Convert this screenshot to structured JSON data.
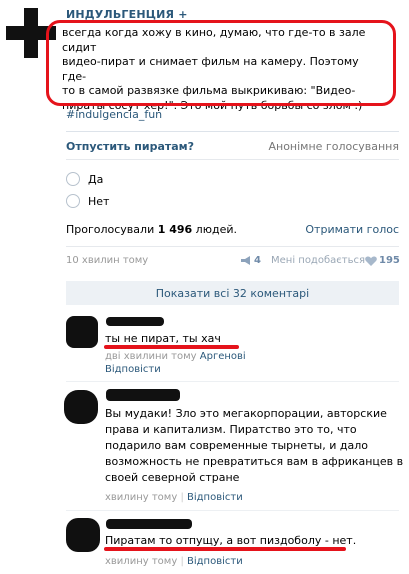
{
  "post": {
    "group_name": "ИНДУЛЬГЕНЦИЯ +",
    "text_lines": [
      "всегда когда хожу в кино, думаю, что где-то в зале сидит",
      "видео-пират и снимает фильм на камеру. Поэтому где-",
      "то в самой развязке фильма выкрикиваю: \"Видео-",
      "пираты сосут хер!\". Это мой путь борьбы со злом :)"
    ],
    "hashtag": "#indulgencia_fun",
    "highlight_color": "#e5131b"
  },
  "poll": {
    "title": "Отпустить пиратам?",
    "type": "Анонімне голосування",
    "options": [
      "Да",
      "Нет"
    ],
    "votes_prefix": "Проголосували ",
    "votes_count": "1 496",
    "votes_suffix": " людей.",
    "results_link": "Отримати голос"
  },
  "footer": {
    "time": "10 хвилин тому",
    "share_count": "4",
    "like_label": "Мені подобається",
    "like_count": "195"
  },
  "show_comments": "Показати всі 32 коментарі",
  "comments": [
    {
      "text": "ты не пират, ты хач",
      "meta_time": "дві хвилини тому",
      "meta_reply_to": "Аргенові",
      "reply": "Відповісти"
    },
    {
      "text_lines": [
        "Вы мудаки! Зло это мегакорпорации, авторские",
        "права и капитализм. Пиратство это то, что",
        "подарило вам современные тырнеты, и дало",
        "возможность не превратиться вам в африканцев в",
        "своей северной стране"
      ],
      "meta_time": "хвилину тому",
      "reply": "Відповісти"
    },
    {
      "text": "Пиратам то отпущу, а вот пиздоболу - нет.",
      "meta_time": "хвилину тому",
      "reply": "Відповісти"
    }
  ]
}
